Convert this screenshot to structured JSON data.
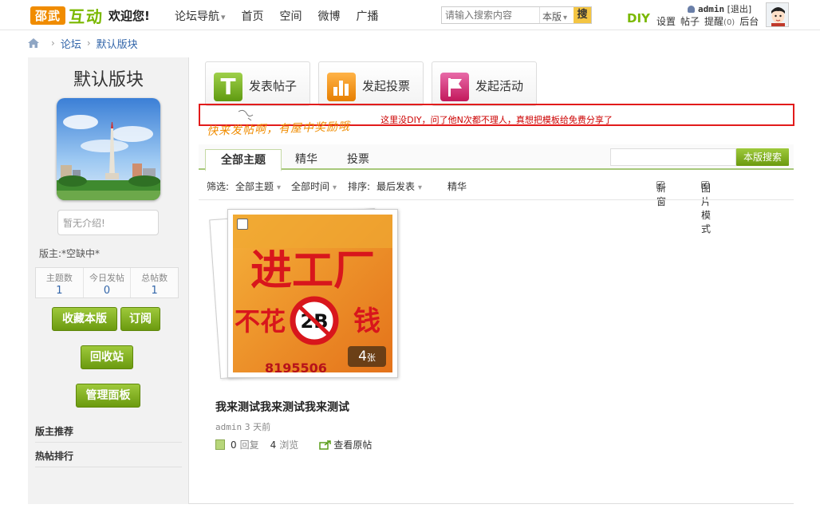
{
  "header": {
    "logo_part1": "邵武",
    "logo_part2": "互动",
    "welcome": "欢迎您!",
    "nav": [
      {
        "label": "论坛导航",
        "dropdown": true
      },
      {
        "label": "首页"
      },
      {
        "label": "空间"
      },
      {
        "label": "微博"
      },
      {
        "label": "广播"
      }
    ],
    "search": {
      "placeholder": "请输入搜索内容",
      "scope": "本版",
      "button": "搜"
    },
    "diy": "DIY",
    "username": "admin",
    "logout": "[退出]",
    "links": [
      "设置",
      "帖子",
      "提醒"
    ],
    "remind_count": "(0)",
    "admin_link": "后台"
  },
  "breadcrumb": [
    "论坛",
    "默认版块"
  ],
  "sidebar": {
    "forum_name": "默认版块",
    "intro": "暂无介绍!",
    "moderator": "版主:*空缺中*",
    "stats": [
      {
        "label": "主题数",
        "value": "1"
      },
      {
        "label": "今日发帖",
        "value": "0"
      },
      {
        "label": "总帖数",
        "value": "1"
      }
    ],
    "buttons": {
      "favorite": "收藏本版",
      "subscribe": "订阅",
      "recycle": "回收站",
      "manage": "管理面板"
    },
    "links": [
      "版主推荐",
      "热帖排行"
    ]
  },
  "actions": {
    "post": "发表帖子",
    "poll": "发起投票",
    "activity": "发起活动"
  },
  "diy_notice": "这里没DIY，问了他N次都不理人，真想把模板给免费分享了",
  "handwritten_note": "快来发帖啊，有屋中奖励哦",
  "tabs": {
    "items": [
      "全部主题",
      "精华",
      "投票"
    ],
    "search_button": "本版搜索"
  },
  "filters": {
    "label": "筛选:",
    "all_threads": "全部主题",
    "all_time": "全部时间",
    "sort_label": "排序:",
    "sort_value": "最后发表",
    "digest": "精华",
    "new_window": "新窗",
    "image_mode": "图片模式"
  },
  "thread": {
    "image_texts": {
      "top": "进工厂",
      "left": "不花",
      "badge": "2B",
      "right": "钱",
      "bottom": "8195506"
    },
    "image_count": "4",
    "image_unit": "张",
    "title": "我来测试我来测试我来测试",
    "author": "admin",
    "time": "3 天前",
    "replies": "0",
    "replies_label": "回复",
    "views": "4",
    "views_label": "浏览",
    "view_original": "查看原帖"
  },
  "colors": {
    "accent_green": "#7ab800",
    "logo_orange": "#f08c00",
    "notice_red": "#e21b1b",
    "link_blue": "#3366aa"
  }
}
